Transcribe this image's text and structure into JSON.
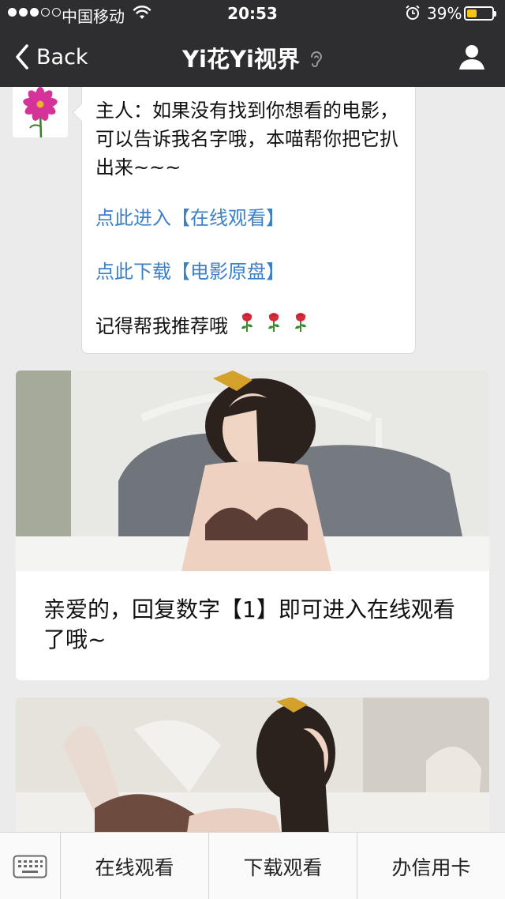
{
  "status_bar": {
    "carrier": "中国移动",
    "time": "20:53",
    "battery_percent": "39%",
    "battery_level": 0.39,
    "signal_bars_filled": 3,
    "signal_bars_total": 5,
    "icons": [
      "wifi-icon",
      "alarm-icon",
      "battery-icon"
    ]
  },
  "nav": {
    "back_label": "Back",
    "title": "Yi花Yi视界",
    "icons": [
      "chevron-left-icon",
      "ear-icon",
      "person-icon"
    ]
  },
  "message": {
    "avatar_icon": "pink-flower-avatar",
    "intro": "主人：如果没有找到你想看的电影，可以告诉我名字哦，本喵帮你把它扒出来~~~",
    "link_online": "点此进入【在线观看】",
    "link_download": "点此下载【电影原盘】",
    "reminder": "记得帮我推荐哦",
    "reminder_icon": "rose-emoji",
    "rose_count": 3
  },
  "cards": [
    {
      "image": "woman-photo-on-bed",
      "text": "亲爱的，回复数字【1】即可进入在线观看了哦~"
    },
    {
      "image": "woman-photo-lying-on-bed"
    }
  ],
  "bottom_menu": {
    "keyboard_icon": "keyboard-icon",
    "items": [
      "在线观看",
      "下载观看",
      "办信用卡"
    ]
  },
  "colors": {
    "nav_bg": "#2e2e31",
    "chat_bg": "#ebebeb",
    "link": "#3c80c6",
    "battery": "#f5c518"
  }
}
